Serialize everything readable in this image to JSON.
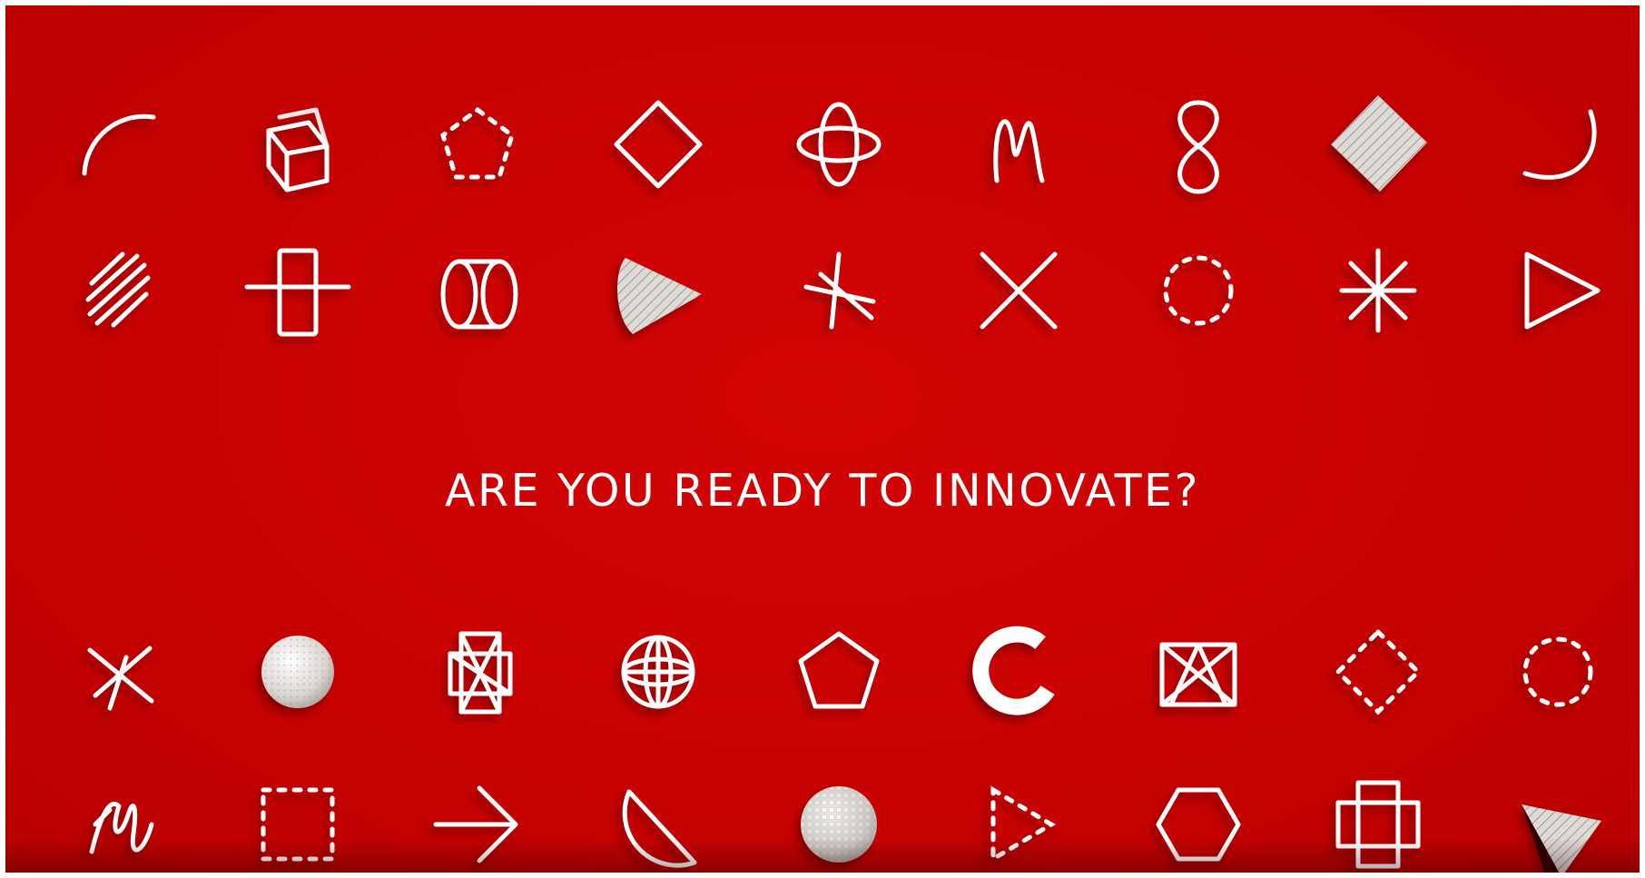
{
  "headline": "ARE YOU READY TO INNOVATE?",
  "colors": {
    "background": "#c80202",
    "foreground": "#ffffff",
    "solid_fill": "#d8d5d2"
  },
  "icon_rows": [
    [
      "arc-icon",
      "cube-icon",
      "dashed-pentagon-icon",
      "diamond-icon",
      "orbit-icon",
      "letter-m-icon",
      "figure-eight-icon",
      "patterned-diamond-icon",
      "hook-arc-icon"
    ],
    [
      "diagonal-stripes-icon",
      "square-crossbar-icon",
      "cylinder-icon",
      "cone-icon",
      "asterisk-sketch-icon",
      "x-cross-icon",
      "dashed-circle-icon",
      "asterisk-icon",
      "triangle-play-icon"
    ],
    [
      "x-cross-slash-icon",
      "sphere-icon",
      "star-prism-icon",
      "wire-sphere-icon",
      "pentagon-icon",
      "thick-ring-icon",
      "crossed-box-icon",
      "dashed-diamond-icon",
      "dashed-ring-icon"
    ],
    [
      "zigzag-icon",
      "dashed-square-icon",
      "arrow-right-icon",
      "half-circle-icon",
      "sphere-pattern-icon",
      "dashed-play-icon",
      "hexagon-icon",
      "double-square-icon",
      "pyramid-icon"
    ]
  ]
}
